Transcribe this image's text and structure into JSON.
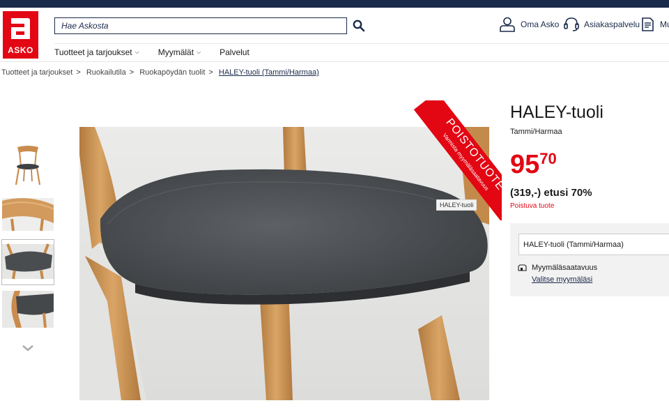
{
  "brand": {
    "logo_text": "ASKO",
    "color": "#e30613",
    "navy": "#1a2a4a"
  },
  "search": {
    "placeholder": "Hae Askosta",
    "icon": "search-icon"
  },
  "header_links": [
    {
      "label": "Oma Asko",
      "icon": "user-icon"
    },
    {
      "label": "Asiakaspalvelu",
      "icon": "headset-icon"
    },
    {
      "label": "Mu",
      "icon": "document-icon"
    }
  ],
  "nav": {
    "items": [
      {
        "label": "Tuotteet ja tarjoukset",
        "has_dropdown": true
      },
      {
        "label": "Myymälät",
        "has_dropdown": true
      },
      {
        "label": "Palvelut",
        "has_dropdown": false
      }
    ]
  },
  "breadcrumb": [
    "Tuotteet ja tarjoukset",
    "Ruokailutila",
    "Ruokapöydän tuolit",
    "HALEY-tuoli (Tammi/Harmaa)"
  ],
  "gallery": {
    "thumbnails": [
      "chair-full",
      "backrest",
      "seat-front",
      "seat-side"
    ],
    "selected_index": 2,
    "image_label": "HALEY-tuoli"
  },
  "badge": {
    "title": "POISTOTUOTE",
    "subtitle": "Varmista myymäläsaatavuus"
  },
  "product": {
    "name": "HALEY-tuoli",
    "variant": "Tammi/Harmaa",
    "price_main": "95",
    "price_cents": "70",
    "previous_price": "(319,-) etusi 70%",
    "status": "Poistuva tuote",
    "select_value": "HALEY-tuoli (Tammi/Harmaa)",
    "store_label": "Myymäläsaatavuus",
    "store_link": "Valitse myymäläsi"
  }
}
